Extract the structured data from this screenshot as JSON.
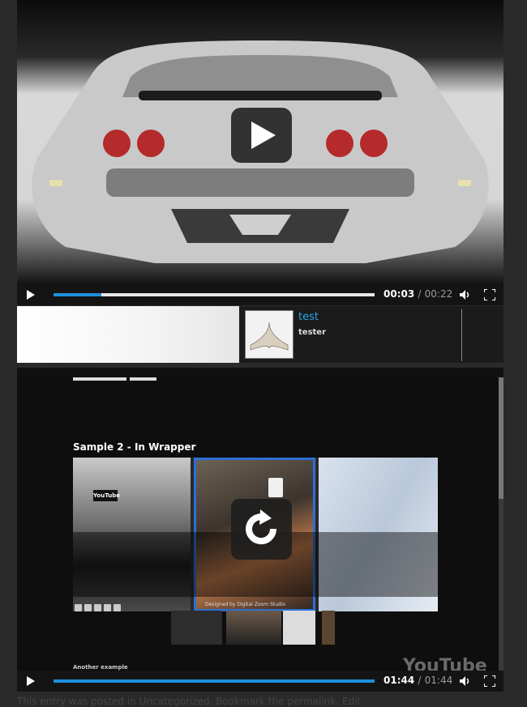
{
  "player1": {
    "current_time": "00:03",
    "separator": "/",
    "duration": "00:22",
    "progress_fraction": 0.15
  },
  "playlist": {
    "item_title": "test",
    "item_subtitle": "tester"
  },
  "player2": {
    "current_time": "01:44",
    "separator": "/",
    "duration": "01:44",
    "progress_fraction": 1.0,
    "embedded_page": {
      "title": "Sample 2 - In Wrapper",
      "designed_by": "Designed by Digital Zoom Studio",
      "another_example": "Another example",
      "logo_text": "YouTube",
      "watermark": "YouTube"
    }
  },
  "footer": {
    "text": "This entry was posted in Uncategorized. Bookmark the permalink. Edit"
  },
  "colors": {
    "accent": "#1e8fdc",
    "link": "#2aa3e6"
  },
  "icons": [
    "play-icon",
    "volume-icon",
    "fullscreen-icon",
    "replay-icon"
  ]
}
